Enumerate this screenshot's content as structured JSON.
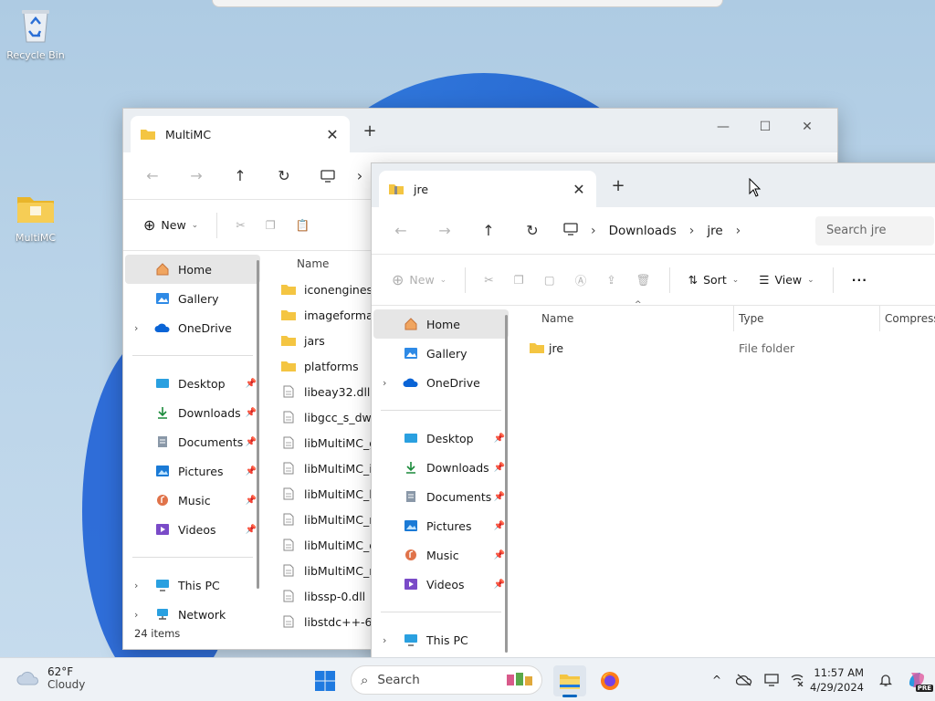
{
  "desktop": {
    "icons": [
      {
        "label": "Recycle Bin"
      },
      {
        "label": "MultiMC"
      }
    ]
  },
  "win_multimc": {
    "tab_title": "MultiMC",
    "new_label": "New",
    "column_name": "Name",
    "sidebar": {
      "quick": [
        "Home",
        "Gallery",
        "OneDrive"
      ],
      "pinned": [
        "Desktop",
        "Downloads",
        "Documents",
        "Pictures",
        "Music",
        "Videos"
      ],
      "system": [
        "This PC",
        "Network"
      ]
    },
    "files": [
      {
        "name": "iconengines",
        "kind": "folder"
      },
      {
        "name": "imageformats",
        "kind": "folder"
      },
      {
        "name": "jars",
        "kind": "folder"
      },
      {
        "name": "platforms",
        "kind": "folder"
      },
      {
        "name": "libeay32.dll",
        "kind": "file"
      },
      {
        "name": "libgcc_s_dw2-",
        "kind": "file"
      },
      {
        "name": "libMultiMC_gu",
        "kind": "file"
      },
      {
        "name": "libMultiMC_ic",
        "kind": "file"
      },
      {
        "name": "libMultiMC_lo",
        "kind": "file"
      },
      {
        "name": "libMultiMC_nl",
        "kind": "file"
      },
      {
        "name": "libMultiMC_qu",
        "kind": "file"
      },
      {
        "name": "libMultiMC_ra",
        "kind": "file"
      },
      {
        "name": "libssp-0.dll",
        "kind": "file"
      },
      {
        "name": "libstdc++-6.dl",
        "kind": "file"
      }
    ],
    "status": "24 items"
  },
  "win_jre": {
    "tab_title": "jre",
    "breadcrumb": [
      "Downloads",
      "jre"
    ],
    "search_placeholder": "Search jre",
    "new_label": "New",
    "sort_label": "Sort",
    "view_label": "View",
    "columns": [
      "Name",
      "Type",
      "Compress"
    ],
    "sidebar": {
      "quick": [
        "Home",
        "Gallery",
        "OneDrive"
      ],
      "pinned": [
        "Desktop",
        "Downloads",
        "Documents",
        "Pictures",
        "Music",
        "Videos"
      ],
      "system": [
        "This PC"
      ]
    },
    "rows": [
      {
        "name": "jre",
        "type": "File folder"
      }
    ]
  },
  "taskbar": {
    "weather_temp": "62°F",
    "weather_text": "Cloudy",
    "search_label": "Search",
    "time": "11:57 AM",
    "date": "4/29/2024",
    "copilot_badge": "PRE"
  },
  "colors": {
    "accent": "#0067c0",
    "folder": "#f4c542",
    "selected": "#e6e6e6"
  }
}
